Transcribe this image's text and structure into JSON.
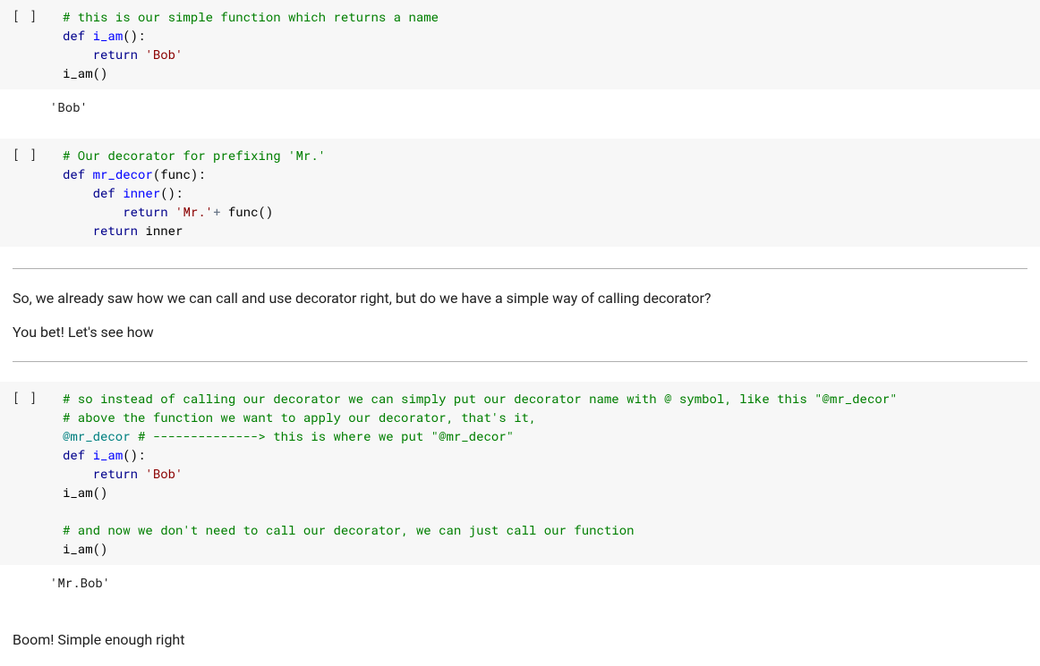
{
  "prompts": {
    "code": "[ ]"
  },
  "cells": {
    "c1": {
      "out": "'Bob'",
      "l1_comment": "# this is our simple function which returns a name",
      "l2_def": "def",
      "l2_name": " i_am",
      "l2_rest": "():",
      "l3_ret": "return",
      "l3_str": " 'Bob'",
      "l4_call": "i_am()"
    },
    "c2": {
      "l1_comment": "# Our decorator for prefixing 'Mr.'",
      "l2_def": "def",
      "l2_name": " mr_decor",
      "l2_rest": "(func):",
      "l3_def": "def",
      "l3_name": " inner",
      "l3_rest": "():",
      "l4_ret": "return",
      "l4_str": " 'Mr.'",
      "l4_plus": "+",
      "l4_rest": " func()",
      "l5_ret": "return",
      "l5_rest": " inner"
    },
    "c3": {
      "out": "'Mr.Bob'",
      "l1_comment": "# so instead of calling our decorator we can simply put our decorator name with @ symbol, like this \"@mr_decor\"",
      "l2_comment": "# above the function we want to apply our decorator, that's it,",
      "l3_deco": "@mr_decor",
      "l3_comment": " # --------------> this is where we put \"@mr_decor\"",
      "l4_def": "def",
      "l4_name": " i_am",
      "l4_rest": "():",
      "l5_ret": "return",
      "l5_str": " 'Bob'",
      "l6_call": "i_am()",
      "l8_comment": "# and now we don't need to call our decorator, we can just call our function",
      "l9_call": "i_am()"
    }
  },
  "markdown": {
    "m1a": "So, we already saw how we can call and use decorator right, but do we have a simple way of calling decorator?",
    "m1b": "You bet! Let's see how",
    "m2": "Boom! Simple enough right"
  }
}
